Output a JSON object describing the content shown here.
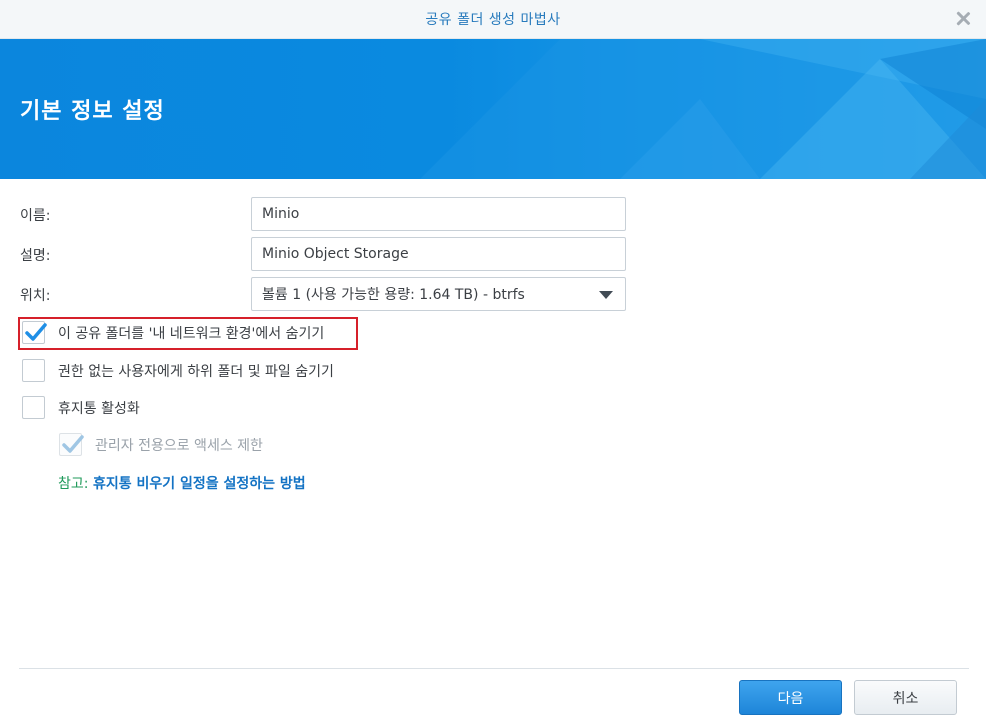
{
  "window": {
    "title": "공유 폴더 생성 마법사",
    "close_icon": "close-icon"
  },
  "banner": {
    "heading": "기본 정보 설정"
  },
  "form": {
    "name": {
      "label": "이름:",
      "value": "Minio"
    },
    "description": {
      "label": "설명:",
      "value": "Minio Object Storage"
    },
    "location": {
      "label": "위치:",
      "value": "볼륨 1 (사용 가능한 용량:  1.64 TB) - btrfs"
    }
  },
  "options": {
    "hide_in_network": {
      "label": "이 공유 폴더를 '내 네트워크 환경'에서 숨기기",
      "checked": true
    },
    "hide_subfolders": {
      "label": "권한 없는 사용자에게 하위 폴더 및 파일 숨기기",
      "checked": false
    },
    "recycle_bin": {
      "label": "휴지통 활성화",
      "checked": false
    },
    "admin_only": {
      "label": "관리자 전용으로 액세스 제한",
      "checked": true,
      "disabled": true
    }
  },
  "note": {
    "prefix": "참고:",
    "link": "휴지통 비우기 일정을 설정하는 방법"
  },
  "footer": {
    "next_label": "다음",
    "cancel_label": "취소"
  },
  "colors": {
    "accent": "#0b86dd",
    "highlight": "#d6202a",
    "check": "#1f8fe6"
  }
}
